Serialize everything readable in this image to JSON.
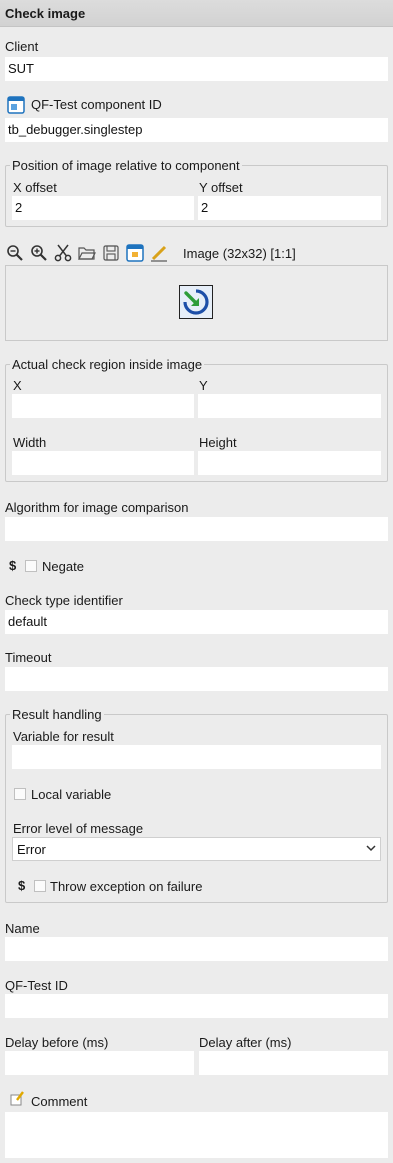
{
  "title": "Check image",
  "client": {
    "label": "Client",
    "value": "SUT"
  },
  "component": {
    "label": "QF-Test component ID",
    "value": "tb_debugger.singlestep"
  },
  "position": {
    "title": "Position of image relative to component",
    "x_label": "X offset",
    "x_value": "2",
    "y_label": "Y offset",
    "y_value": "2"
  },
  "toolbar": {
    "icons": [
      "zoom-out-icon",
      "zoom-in-icon",
      "cut-icon",
      "open-folder-icon",
      "save-icon",
      "window-icon",
      "edit-pencil-icon"
    ],
    "image_info": "Image (32x32) [1:1]"
  },
  "region": {
    "title": "Actual check region inside image",
    "x_label": "X",
    "x_value": "",
    "y_label": "Y",
    "y_value": "",
    "width_label": "Width",
    "width_value": "",
    "height_label": "Height",
    "height_value": ""
  },
  "algorithm": {
    "label": "Algorithm for image comparison",
    "value": ""
  },
  "negate": {
    "dollar": "$",
    "label": "Negate",
    "checked": false
  },
  "check_type": {
    "label": "Check type identifier",
    "value": "default"
  },
  "timeout": {
    "label": "Timeout",
    "value": ""
  },
  "result": {
    "title": "Result handling",
    "variable_label": "Variable for result",
    "variable_value": "",
    "local_label": "Local variable",
    "error_level_label": "Error level of message",
    "error_level_value": "Error",
    "throw_dollar": "$",
    "throw_label": "Throw exception on failure"
  },
  "name": {
    "label": "Name",
    "value": ""
  },
  "qftest_id": {
    "label": "QF-Test ID",
    "value": ""
  },
  "delay": {
    "before_label": "Delay before (ms)",
    "before_value": "",
    "after_label": "Delay after (ms)",
    "after_value": ""
  },
  "comment": {
    "label": "Comment",
    "value": ""
  },
  "colors": {
    "background": "#ececec",
    "field": "#ffffff",
    "accent_blue": "#1e73be",
    "accent_green": "#2e9d3a"
  }
}
